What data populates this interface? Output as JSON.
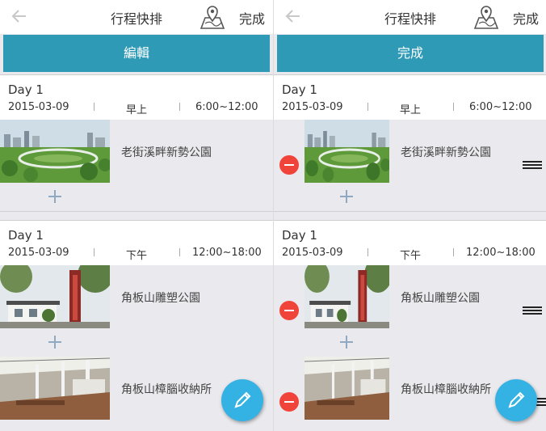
{
  "screens": [
    {
      "header": {
        "title": "行程快排",
        "done_label": "完成"
      },
      "action_button_label": "編輯",
      "days": [
        {
          "day_label": "Day 1",
          "date": "2015-03-09",
          "period": "早上",
          "time_range": "6:00~12:00",
          "places": [
            {
              "name": "老街溪畔新勢公園"
            }
          ]
        },
        {
          "day_label": "Day 1",
          "date": "2015-03-09",
          "period": "下午",
          "time_range": "12:00~18:00",
          "places": [
            {
              "name": "角板山雕塑公園"
            },
            {
              "name": "角板山樟腦收納所"
            }
          ]
        }
      ]
    },
    {
      "header": {
        "title": "行程快排",
        "done_label": "完成"
      },
      "action_button_label": "完成",
      "days": [
        {
          "day_label": "Day 1",
          "date": "2015-03-09",
          "period": "早上",
          "time_range": "6:00~12:00",
          "places": [
            {
              "name": "老街溪畔新勢公園"
            }
          ]
        },
        {
          "day_label": "Day 1",
          "date": "2015-03-09",
          "period": "下午",
          "time_range": "12:00~18:00",
          "places": [
            {
              "name": "角板山雕塑公園"
            },
            {
              "name": "角板山樟腦收納所"
            }
          ]
        }
      ]
    }
  ],
  "icons": {
    "back": "back-arrow-icon",
    "map": "map-pin-icon",
    "add": "plus-icon",
    "remove": "minus-circle-icon",
    "drag": "drag-handle-icon",
    "edit": "pencil-icon"
  },
  "colors": {
    "accent": "#2f9ab5",
    "fab": "#34b2e4",
    "remove": "#f0433a",
    "add": "#8fa9c2",
    "list_background": "#e9e9ee"
  }
}
